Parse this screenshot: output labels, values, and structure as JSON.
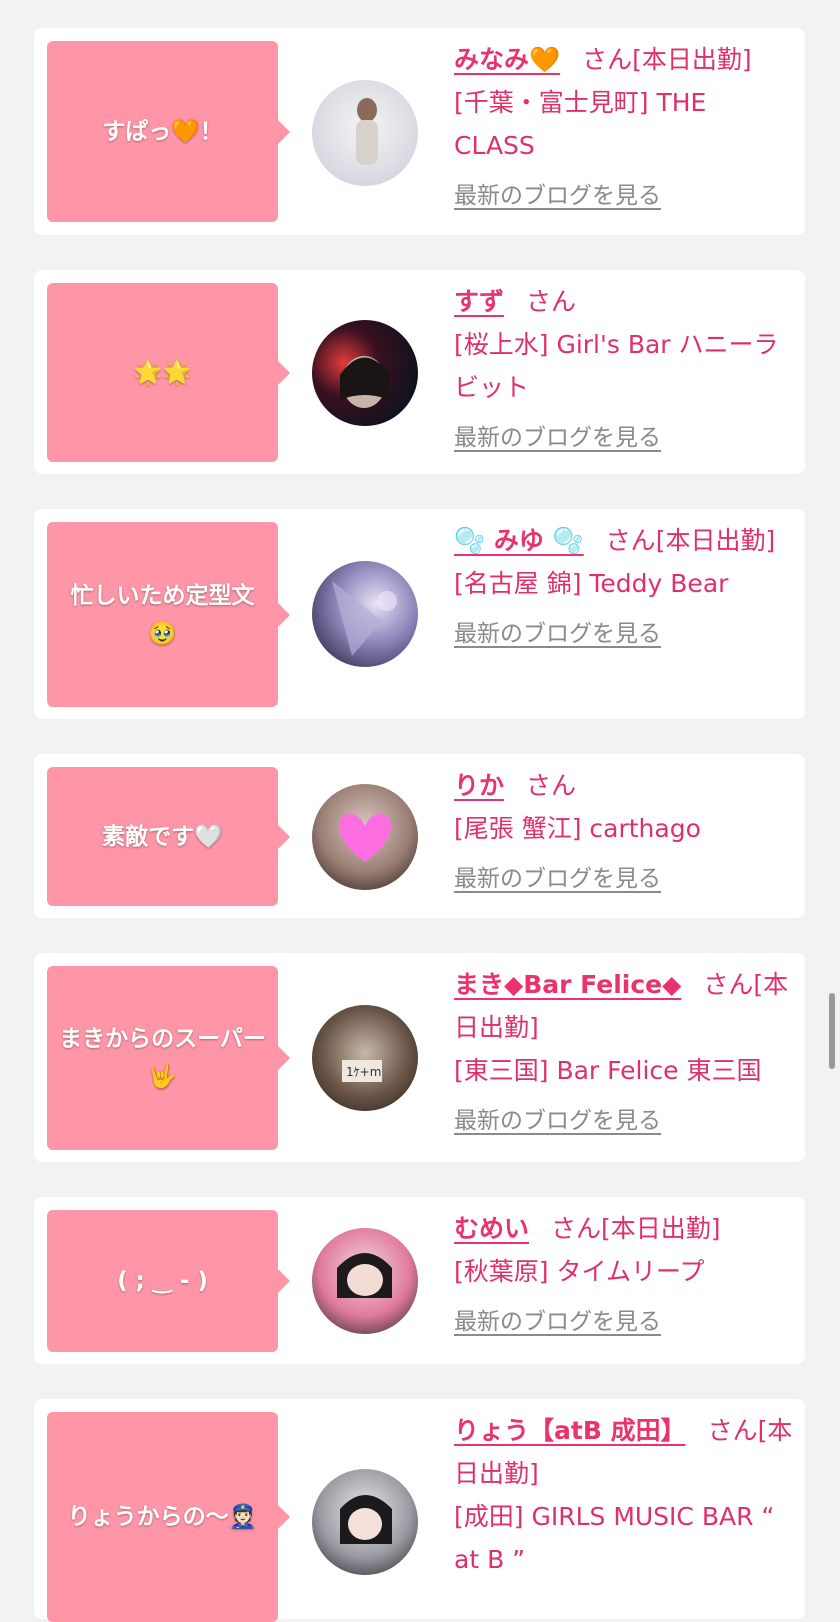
{
  "colors": {
    "bubble": "#ff96a8",
    "accent": "#e8336e",
    "link_gray": "#8a8a8a",
    "background": "#f2f2f2"
  },
  "cards": [
    {
      "message": "すぱっ🧡！",
      "name": "みなみ🧡",
      "san": "さん",
      "status": "[本日出勤]",
      "shop": "[千葉・富士見町] THE CLASS",
      "blog_link": "最新のブログを見る"
    },
    {
      "message": "🌟🌟",
      "name": "すず",
      "san": "さん",
      "status": "",
      "shop": "[桜上水] Girl's Bar ハニーラビット",
      "blog_link": "最新のブログを見る"
    },
    {
      "message": "忙しいため定型文🥹",
      "name": "🫧 みゆ 🫧",
      "san": "さん",
      "status": "[本日出勤]",
      "shop": "[名古屋 錦] Teddy Bear",
      "blog_link": "最新のブログを見る"
    },
    {
      "message": "素敵です🤍",
      "name": "りか",
      "san": "さん",
      "status": "",
      "shop": "[尾張 蟹江] carthago",
      "blog_link": "最新のブログを見る"
    },
    {
      "message": "まきからのスーパー🤟",
      "name": "まき◆Bar Felice◆",
      "san": "さん",
      "status": "[本日出勤]",
      "shop": "[東三国] Bar Felice 東三国",
      "blog_link": "最新のブログを見る"
    },
    {
      "message": "( ; ‿ - )",
      "name": "むめい",
      "san": "さん",
      "status": "[本日出勤]",
      "shop": "[秋葉原] タイムリープ",
      "blog_link": "最新のブログを見る"
    },
    {
      "message": "りょうからの〜👮🏻",
      "name": "りょう【atB 成田】",
      "san": "さん",
      "status": "[本日出勤]",
      "shop": "[成田] GIRLS MUSIC BAR “ at B ”",
      "blog_link": ""
    }
  ]
}
